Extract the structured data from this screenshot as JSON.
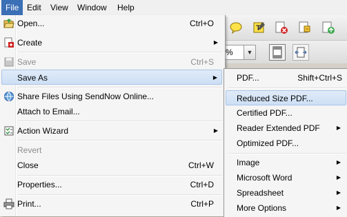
{
  "menubar": {
    "items": [
      {
        "label": "File",
        "active": true
      },
      {
        "label": "Edit",
        "active": false
      },
      {
        "label": "View",
        "active": false
      },
      {
        "label": "Window",
        "active": false
      },
      {
        "label": "Help",
        "active": false
      }
    ]
  },
  "toolbar": {
    "zoom_value": "%",
    "icons": [
      "comment-icon",
      "text-edit-icon",
      "delete-icon",
      "attach-icon",
      "share-icon"
    ]
  },
  "file_menu": {
    "open": {
      "label": "Open...",
      "shortcut": "Ctrl+O"
    },
    "create": {
      "label": "Create"
    },
    "save": {
      "label": "Save",
      "shortcut": "Ctrl+S"
    },
    "save_as": {
      "label": "Save As"
    },
    "share": {
      "label": "Share Files Using SendNow Online..."
    },
    "attach": {
      "label": "Attach to Email..."
    },
    "action_wizard": {
      "label": "Action Wizard"
    },
    "revert": {
      "label": "Revert"
    },
    "close": {
      "label": "Close",
      "shortcut": "Ctrl+W"
    },
    "properties": {
      "label": "Properties...",
      "shortcut": "Ctrl+D"
    },
    "print": {
      "label": "Print...",
      "shortcut": "Ctrl+P"
    }
  },
  "save_as_menu": {
    "pdf": {
      "label": "PDF...",
      "shortcut": "Shift+Ctrl+S"
    },
    "reduced": {
      "label": "Reduced Size PDF..."
    },
    "certified": {
      "label": "Certified PDF..."
    },
    "reader_extended": {
      "label": "Reader Extended PDF"
    },
    "optimized": {
      "label": "Optimized PDF..."
    },
    "image": {
      "label": "Image"
    },
    "word": {
      "label": "Microsoft Word"
    },
    "spreadsheet": {
      "label": "Spreadsheet"
    },
    "more": {
      "label": "More Options"
    }
  },
  "colors": {
    "menu_active": "#3b6fb6",
    "highlight": "#cddff5"
  }
}
